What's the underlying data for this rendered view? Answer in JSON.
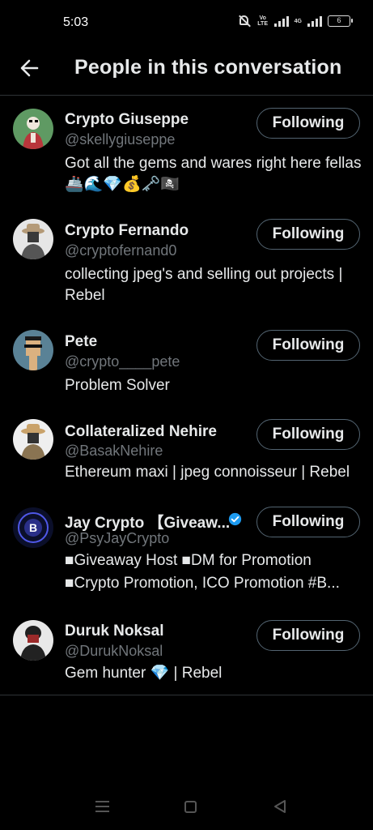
{
  "status_bar": {
    "time": "5:03",
    "network_label": "Vo LTE",
    "network_type": "4G",
    "battery_level": "6"
  },
  "header": {
    "title": "People in this conversation",
    "back_icon": "arrow-left-icon"
  },
  "people": [
    {
      "name": "Crypto Giuseppe",
      "handle": "@skellygiuseppe",
      "bio": "Got all the gems and wares right here fellas 🚢🌊💎💰🗝️🏴‍☠️",
      "button": "Following",
      "verified": false,
      "avatar_bg": "#5f9a63"
    },
    {
      "name": "Crypto Fernando",
      "handle": "@cryptofernand0",
      "bio": "collecting jpeg's and selling out projects | Rebel",
      "button": "Following",
      "verified": false,
      "avatar_bg": "#e6e6e6"
    },
    {
      "name": "Pete",
      "handle": "@crypto____pete",
      "bio": "Problem Solver",
      "button": "Following",
      "verified": false,
      "avatar_bg": "#5a8296"
    },
    {
      "name": "Collateralized Nehire",
      "handle": "@BasakNehire",
      "bio": "Ethereum maxi | jpeg connoisseur | Rebel",
      "button": "Following",
      "verified": false,
      "avatar_bg": "#efefef"
    },
    {
      "name": "Jay Crypto 【Giveaw...",
      "handle": "@PsyJayCrypto",
      "bio": "■Giveaway Host ■DM for Promotion ■Crypto Promotion, ICO Promotion #B...",
      "button": "Following",
      "verified": true,
      "avatar_bg": "#0b0f2a"
    },
    {
      "name": "Duruk Noksal",
      "handle": "@DurukNoksal",
      "bio": "Gem hunter 💎 | Rebel",
      "button": "Following",
      "verified": false,
      "avatar_bg": "#e8e8e8"
    }
  ],
  "colors": {
    "background": "#000000",
    "text_primary": "#e7e9ea",
    "text_secondary": "#71767b",
    "divider": "#2f3336",
    "verified": "#1d9bf0"
  }
}
